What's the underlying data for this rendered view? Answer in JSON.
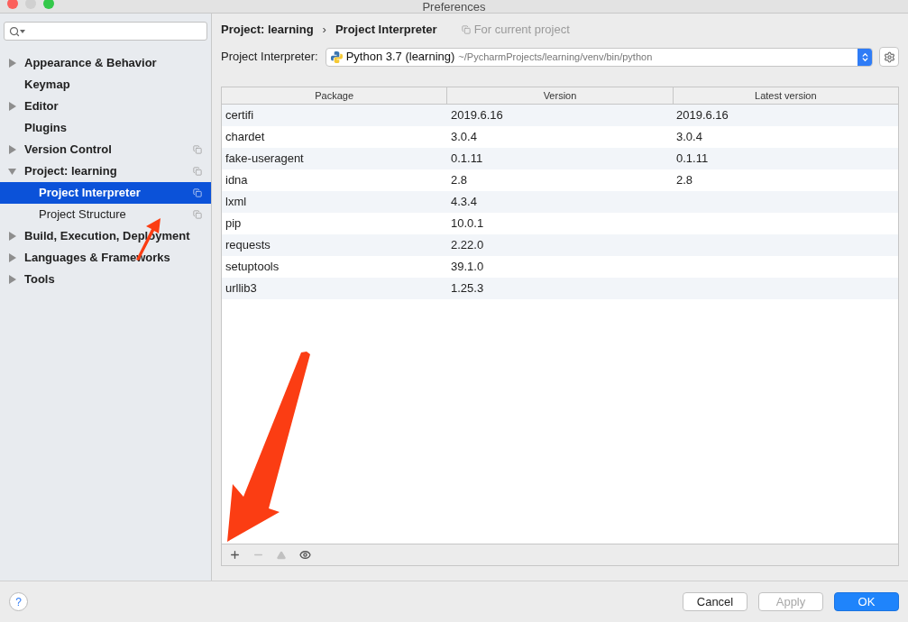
{
  "window": {
    "title": "Preferences"
  },
  "sidebar": {
    "items": [
      {
        "label": "Appearance & Behavior",
        "expandable": true,
        "expanded": false,
        "selected": false,
        "project_scoped": false
      },
      {
        "label": "Keymap",
        "expandable": false,
        "selected": false,
        "project_scoped": false
      },
      {
        "label": "Editor",
        "expandable": true,
        "expanded": false,
        "selected": false,
        "project_scoped": false
      },
      {
        "label": "Plugins",
        "expandable": false,
        "selected": false,
        "project_scoped": false
      },
      {
        "label": "Version Control",
        "expandable": true,
        "expanded": false,
        "selected": false,
        "project_scoped": true
      },
      {
        "label": "Project: learning",
        "expandable": true,
        "expanded": true,
        "selected": false,
        "project_scoped": true,
        "children": [
          {
            "label": "Project Interpreter",
            "selected": true,
            "project_scoped": true
          },
          {
            "label": "Project Structure",
            "selected": false,
            "project_scoped": true
          }
        ]
      },
      {
        "label": "Build, Execution, Deployment",
        "expandable": true,
        "expanded": false,
        "selected": false,
        "project_scoped": false
      },
      {
        "label": "Languages & Frameworks",
        "expandable": true,
        "expanded": false,
        "selected": false,
        "project_scoped": false
      },
      {
        "label": "Tools",
        "expandable": true,
        "expanded": false,
        "selected": false,
        "project_scoped": false
      }
    ]
  },
  "breadcrumb": {
    "parent": "Project: learning",
    "separator": "›",
    "current": "Project Interpreter",
    "scope_note": "For current project"
  },
  "interpreter": {
    "label": "Project Interpreter:",
    "name": "Python 3.7 (learning)",
    "path": "~/PycharmProjects/learning/venv/bin/python"
  },
  "table": {
    "columns": [
      "Package",
      "Version",
      "Latest version"
    ],
    "rows": [
      [
        "certifi",
        "2019.6.16",
        "2019.6.16"
      ],
      [
        "chardet",
        "3.0.4",
        "3.0.4"
      ],
      [
        "fake-useragent",
        "0.1.11",
        "0.1.11"
      ],
      [
        "idna",
        "2.8",
        "2.8"
      ],
      [
        "lxml",
        "4.3.4",
        ""
      ],
      [
        "pip",
        "10.0.1",
        ""
      ],
      [
        "requests",
        "2.22.0",
        ""
      ],
      [
        "setuptools",
        "39.1.0",
        ""
      ],
      [
        "urllib3",
        "1.25.3",
        ""
      ]
    ]
  },
  "toolbar": [
    {
      "kind": "add",
      "disabled": false
    },
    {
      "kind": "remove",
      "disabled": true
    },
    {
      "kind": "upgrade",
      "disabled": true
    },
    {
      "kind": "show",
      "disabled": false
    }
  ],
  "help": {
    "label": "?"
  },
  "buttons": [
    {
      "label": "Cancel",
      "kind": "normal",
      "disabled": false
    },
    {
      "label": "Apply",
      "kind": "normal",
      "disabled": true
    },
    {
      "label": "OK",
      "kind": "default",
      "disabled": false
    }
  ]
}
